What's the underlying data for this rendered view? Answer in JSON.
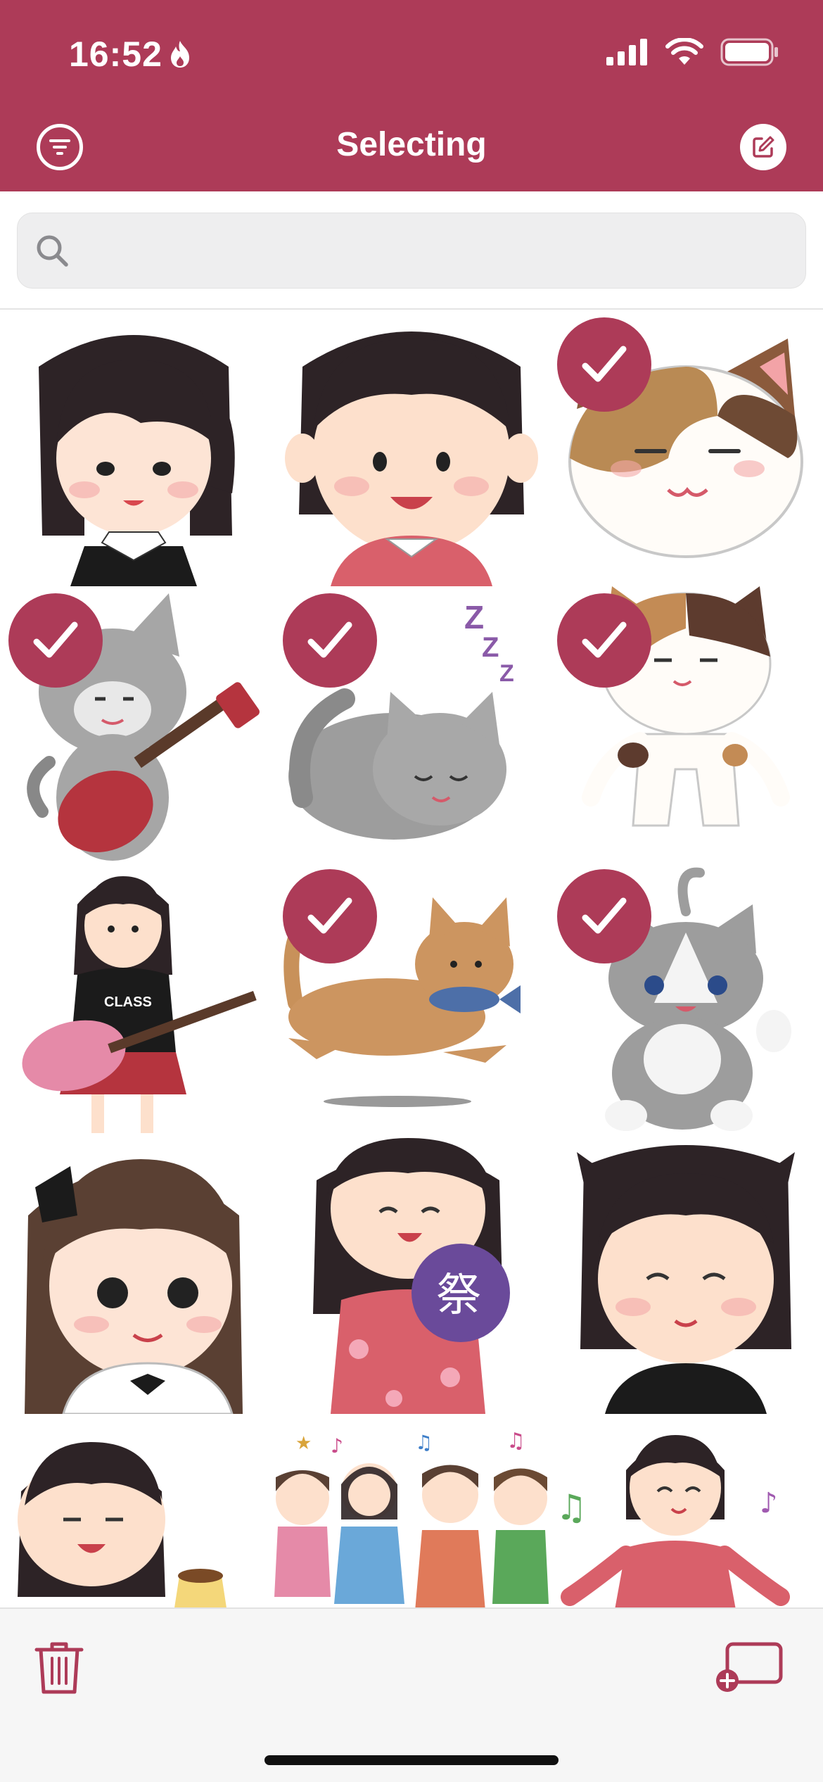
{
  "status_bar": {
    "time": "16:52"
  },
  "header": {
    "title": "Selecting"
  },
  "search": {
    "placeholder": "",
    "value": ""
  },
  "colors": {
    "accent": "#ad3b58",
    "background": "#ffffff",
    "bar": "#f6f6f6"
  },
  "grid": {
    "columns": 3,
    "stickers": [
      {
        "name": "girl-twintails",
        "selected": false
      },
      {
        "name": "woman-pink-sweater",
        "selected": false
      },
      {
        "name": "calico-cat-face",
        "selected": true
      },
      {
        "name": "cat-guitar",
        "selected": true
      },
      {
        "name": "sleeping-cat",
        "selected": true
      },
      {
        "name": "calico-cat-standing",
        "selected": true
      },
      {
        "name": "girl-guitar",
        "selected": false
      },
      {
        "name": "cat-with-fish",
        "selected": true
      },
      {
        "name": "gray-cat-sitting",
        "selected": true
      },
      {
        "name": "girl-bow",
        "selected": false
      },
      {
        "name": "girl-festival-fan",
        "selected": false
      },
      {
        "name": "cat-ears-girl",
        "selected": false
      },
      {
        "name": "girl-pudding",
        "selected": false
      },
      {
        "name": "dancing-girls",
        "selected": false
      },
      {
        "name": "dancing-woman",
        "selected": false
      }
    ]
  },
  "toolbar": {
    "delete_icon": "trash-icon",
    "add_icon": "add-to-screen-icon"
  }
}
